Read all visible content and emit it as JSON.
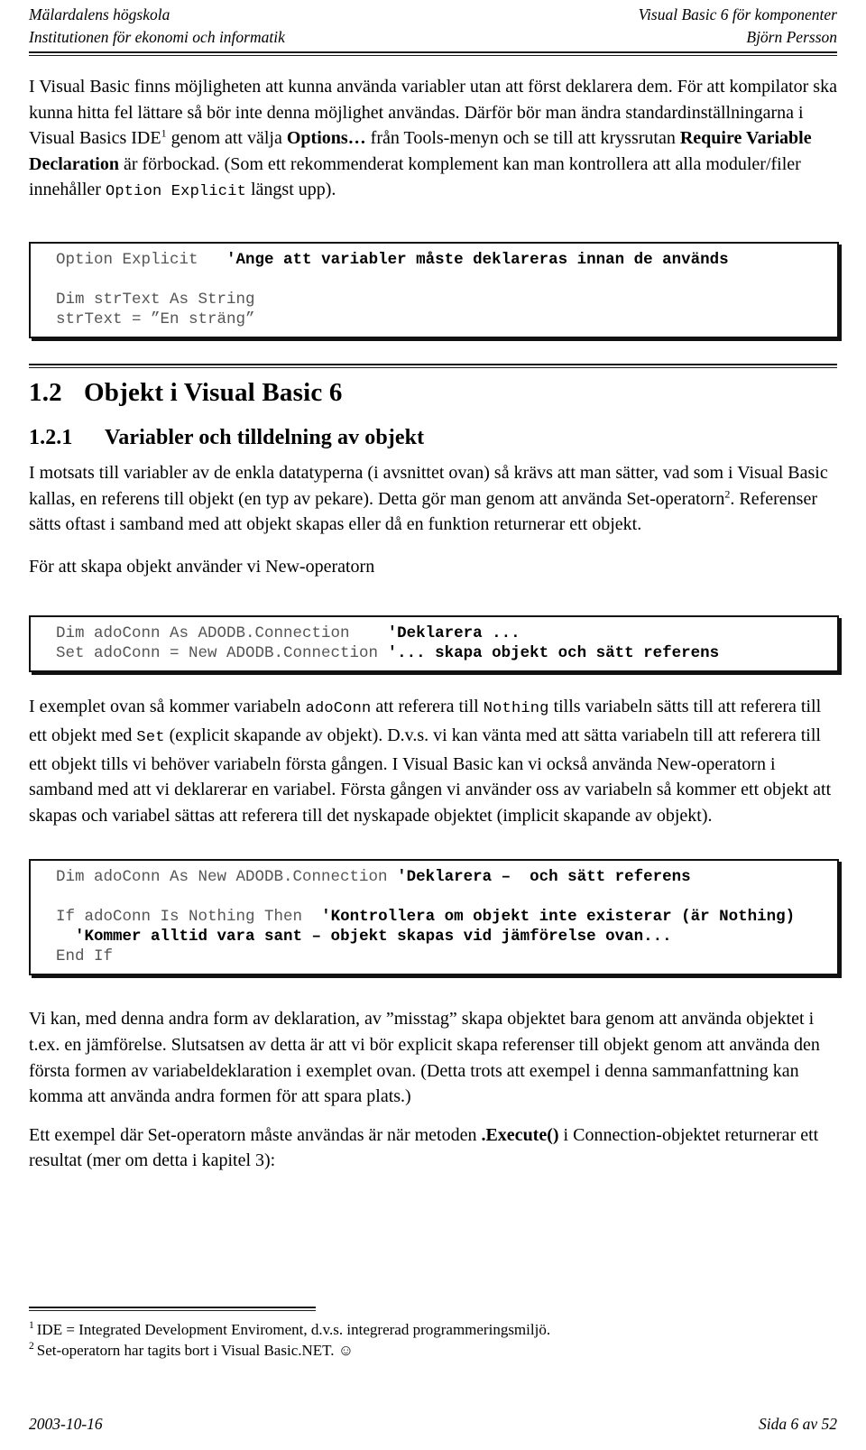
{
  "header": {
    "left_line1": "Mälardalens högskola",
    "left_line2": "Institutionen för ekonomi och informatik",
    "right_line1": "Visual Basic 6 för komponenter",
    "right_line2": "Björn Persson"
  },
  "intro_paragraph": {
    "t1": "I Visual Basic finns möjligheten att kunna använda variabler utan att först deklarera dem. För att kompilator ska kunna hitta fel lättare så bör inte denna möjlighet användas. Därför bör man ändra standardinställningarna i Visual Basics IDE",
    "fn1": "1",
    "t2": " genom att välja ",
    "b1": "Options…",
    "t3": " från Tools-menyn och se till att kryssrutan ",
    "b2": "Require Variable Declaration",
    "t4": " är förbockad. (Som ett rekommenderat komplement kan man kontrollera att alla moduler/filer innehåller ",
    "code1": "Option Explicit",
    "t5": " längst upp)."
  },
  "code_block_1": {
    "line1_code": "Option Explicit",
    "line1_comment": "'Ange att variabler måste deklareras innan de används",
    "line2_blank": "",
    "line3": "Dim strText As String",
    "line4": "strText = ”En sträng”"
  },
  "heading_1_2": {
    "number": "1.2",
    "title": "Objekt i Visual Basic 6"
  },
  "heading_1_2_1": {
    "number": "1.2.1",
    "title": "Variabler och tilldelning av objekt"
  },
  "paragraph_objects": {
    "t1": "I motsats till variabler av de enkla datatyperna (i avsnittet ovan) så krävs att man sätter, vad som i Visual Basic kallas, en referens till objekt (en typ av pekare). Detta gör man genom att använda Set-operatorn",
    "fn2": "2",
    "t2": ". Referenser sätts oftast i samband med att objekt skapas eller då en funktion returnerar ett objekt."
  },
  "paragraph_new_operator": "För att skapa objekt använder vi New-operatorn",
  "code_block_2": {
    "line1_code": "Dim adoConn As ADODB.Connection",
    "line1_comment": "'Deklarera ...",
    "line2_code": "Set adoConn = New ADODB.Connection",
    "line2_comment": "'... skapa objekt och sätt referens"
  },
  "paragraph_example": {
    "t1": "I exemplet ovan så kommer variabeln ",
    "c1": "adoConn",
    "t2": " att referera till ",
    "c2": "Nothing",
    "t3": " tills variabeln sätts till att referera till ett objekt med ",
    "c3": "Set",
    "t4": " (explicit skapande av objekt). D.v.s. vi kan vänta med att sätta variabeln till att referera till ett objekt tills vi behöver variabeln första gången. I Visual Basic kan vi också använda New-operatorn i samband med att vi deklarerar en variabel. Första gången vi använder oss av variabeln så kommer ett objekt att skapas och variabel sättas att referera till det nyskapade objektet (implicit skapande av objekt)."
  },
  "code_block_3": {
    "line1_code": "Dim adoConn As New ADODB.Connection",
    "line1_comment": "'Deklarera –  och sätt referens",
    "line2_blank": "",
    "line3_code": "If adoConn Is Nothing Then",
    "line3_comment": "'Kontrollera om objekt inte existerar (är Nothing)",
    "line4_comment": "'Kommer alltid vara sant – objekt skapas vid jämförelse ovan...",
    "line5_code": "End If"
  },
  "paragraph_conclusion": "Vi kan, med denna andra form av deklaration, av ”misstag” skapa objektet bara genom att använda objektet i t.ex. en jämförelse. Slutsatsen av detta är att vi bör explicit skapa referenser till objekt genom att använda den första formen av variabeldeklaration i exemplet ovan. (Detta trots att exempel i denna sammanfattning kan komma att använda andra formen för att spara plats.)",
  "paragraph_execute": {
    "t1": "Ett exempel där Set-operatorn måste användas är när metoden ",
    "b1": ".Execute()",
    "t2": " i Connection-objektet returnerar ett resultat (mer om detta i kapitel 3):"
  },
  "footnotes": [
    {
      "marker": "1",
      "text": "IDE = Integrated Development Enviroment, d.v.s. integrerad programmeringsmiljö."
    },
    {
      "marker": "2",
      "text": "Set-operatorn har tagits bort i Visual Basic.NET. ☺"
    }
  ],
  "footer": {
    "date": "2003-10-16",
    "page": "Sida 6 av 52"
  }
}
